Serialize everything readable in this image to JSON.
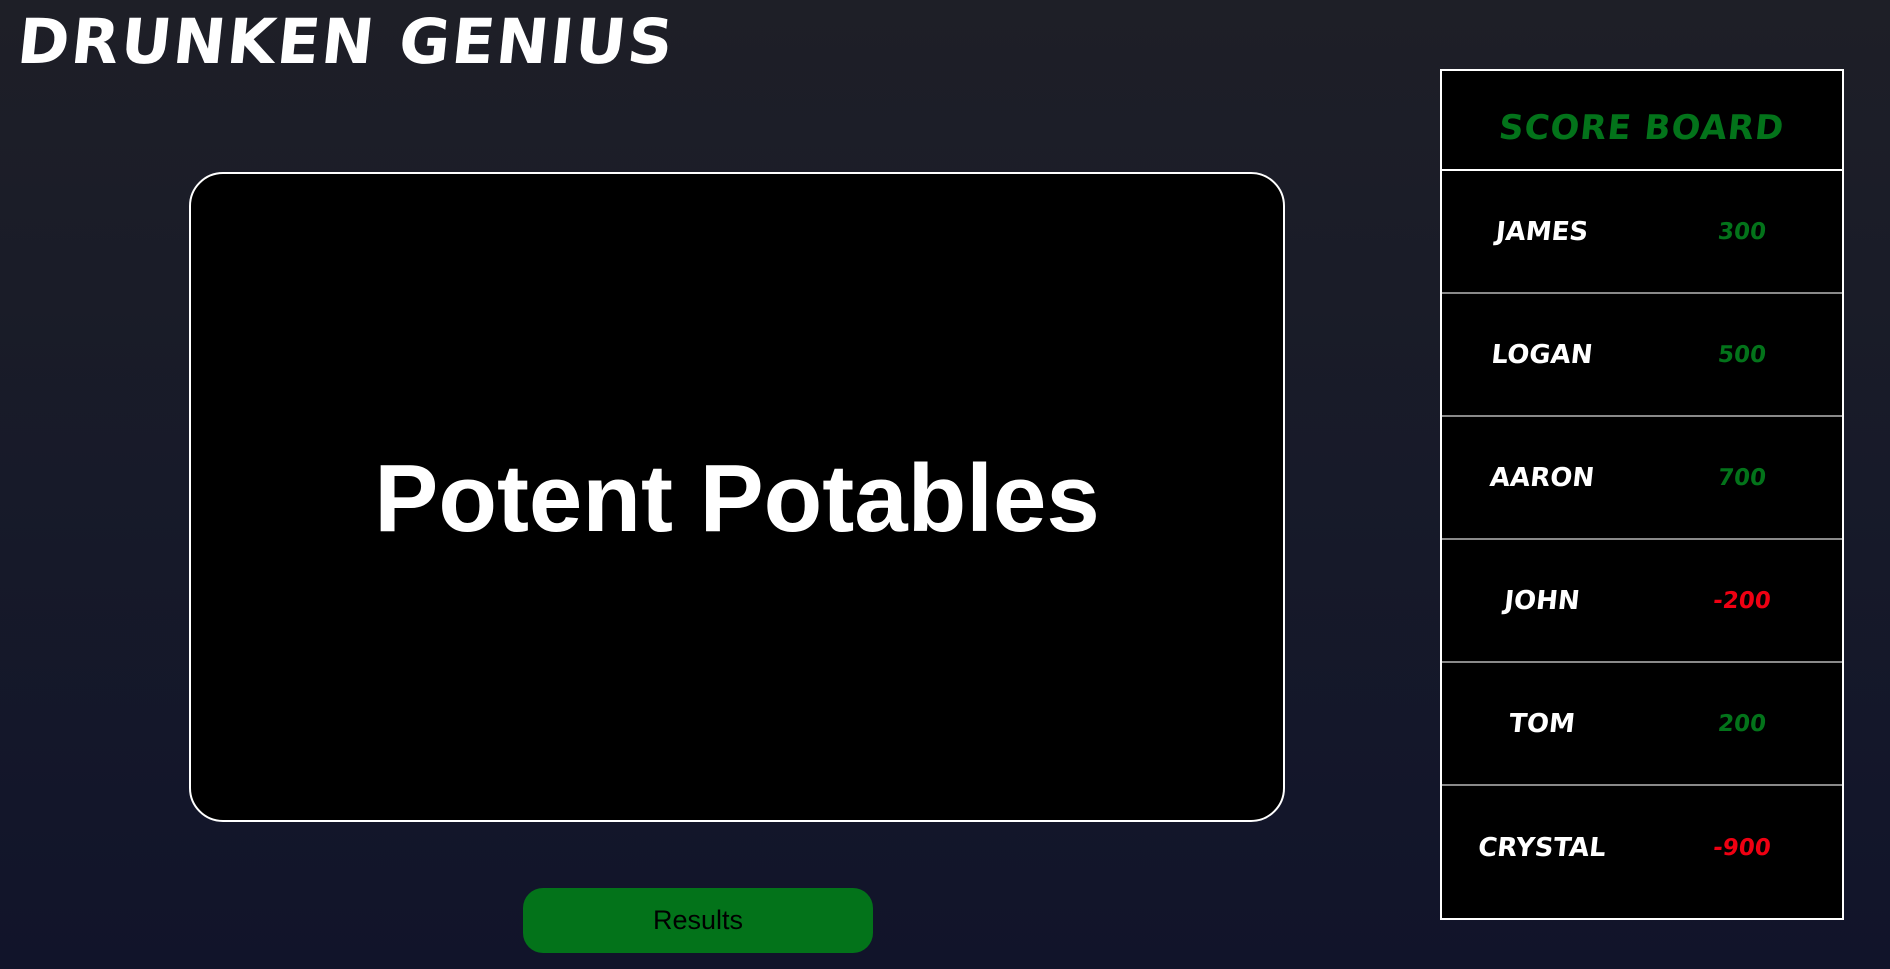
{
  "app": {
    "title": "Drunken Genius"
  },
  "main": {
    "category": "Potent Potables",
    "results_button_label": "Results"
  },
  "scoreboard": {
    "title": "Score Board",
    "positive_color": "#03731a",
    "negative_color": "#ef0012",
    "players": [
      {
        "name": "James",
        "score": "300"
      },
      {
        "name": "Logan",
        "score": "500"
      },
      {
        "name": "Aaron",
        "score": "700"
      },
      {
        "name": "John",
        "score": "-200"
      },
      {
        "name": "Tom",
        "score": "200"
      },
      {
        "name": "Crystal",
        "score": "-900"
      }
    ]
  }
}
